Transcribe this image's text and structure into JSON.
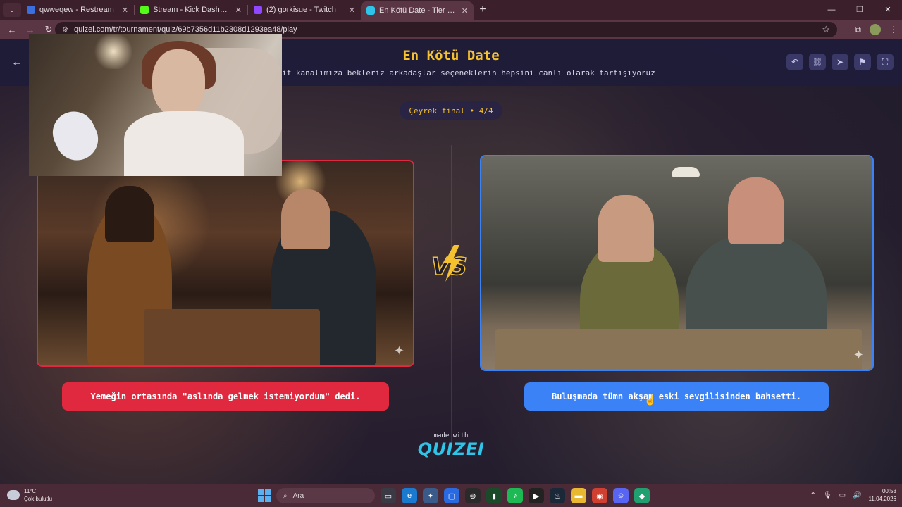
{
  "browser": {
    "tabs": [
      {
        "title": "qwweqew - Restream",
        "favicon_color": "#3b6fe0",
        "active": false
      },
      {
        "title": "Stream - Kick Dashboard",
        "favicon_color": "#53fc18",
        "active": false
      },
      {
        "title": "(2) gorkisue - Twitch",
        "favicon_color": "#9146ff",
        "active": false
      },
      {
        "title": "En Kötü Date - Tier List, Kör Sır",
        "favicon_color": "#2fc4e8",
        "active": true
      }
    ],
    "new_tab_label": "+",
    "url": "quizei.com/tr/tournament/quiz/69b7356d11b2308d1293ea48/play"
  },
  "page": {
    "title": "En Kötü Date",
    "subtitle": "if kanalımıza bekleriz arkadaşlar seçeneklerin hepsini canlı olarak tartışıyoruz",
    "round_badge": "Çeyrek final • 4/4",
    "left_option": {
      "answer": "Yemeğin ortasında \"aslında gelmek istemiyordum\" dedi.",
      "accent": "#e0293f"
    },
    "right_option": {
      "answer": "Buluşmada tümn akşam eski sevgilisinden bahsetti.",
      "accent": "#3b82f6"
    },
    "vs_label": "VS",
    "made_with": "made with",
    "brand": "QUIZEI"
  },
  "taskbar": {
    "weather_temp": "11°C",
    "weather_desc": "Çok bulutlu",
    "search_placeholder": "Ara",
    "time": "00:53",
    "date": "11.04.2026"
  }
}
